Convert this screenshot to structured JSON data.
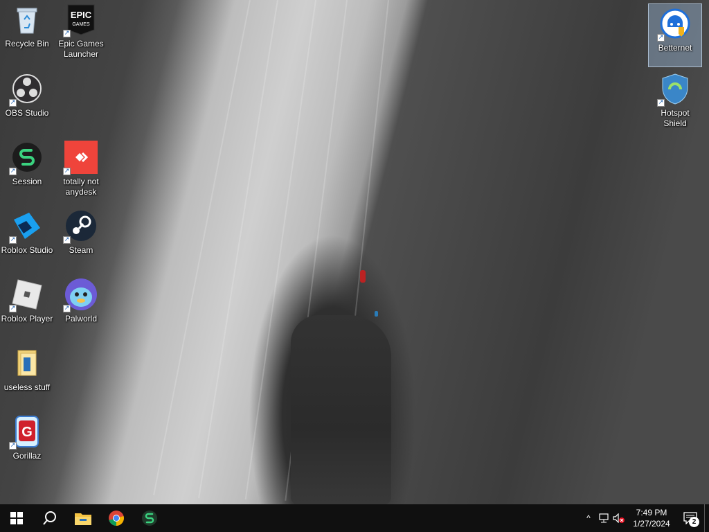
{
  "desktop_icons_left": [
    {
      "label": "Recycle Bin",
      "icon": "recycle-bin-icon"
    },
    {
      "label": "Epic Games\nLauncher",
      "icon": "epic-games-icon",
      "logo_text": "EPIC GAMES"
    },
    {
      "label": "OBS Studio",
      "icon": "obs-studio-icon"
    },
    {
      "label": "Session",
      "icon": "session-icon"
    },
    {
      "label": "totally not\nanydesk",
      "icon": "anydesk-icon"
    },
    {
      "label": "Roblox Studio",
      "icon": "roblox-studio-icon"
    },
    {
      "label": "Steam",
      "icon": "steam-icon"
    },
    {
      "label": "Roblox Player",
      "icon": "roblox-player-icon"
    },
    {
      "label": "Palworld",
      "icon": "palworld-icon"
    },
    {
      "label": "useless stuff",
      "icon": "folder-icon"
    },
    {
      "label": "Gorillaz",
      "icon": "gorillaz-icon"
    }
  ],
  "desktop_icons_right": [
    {
      "label": "Betternet",
      "icon": "betternet-icon",
      "selected": true
    },
    {
      "label": "Hotspot\nShield",
      "icon": "hotspot-shield-icon"
    }
  ],
  "taskbar": {
    "pinned": [
      "start-icon",
      "search-icon",
      "file-explorer-icon",
      "chrome-icon",
      "session-icon"
    ],
    "tray": {
      "time": "7:49 PM",
      "date": "1/27/2024",
      "notification_count": "2"
    }
  },
  "colors": {
    "taskbar_bg": "#101010",
    "accent_blue": "#1b5fb0"
  }
}
